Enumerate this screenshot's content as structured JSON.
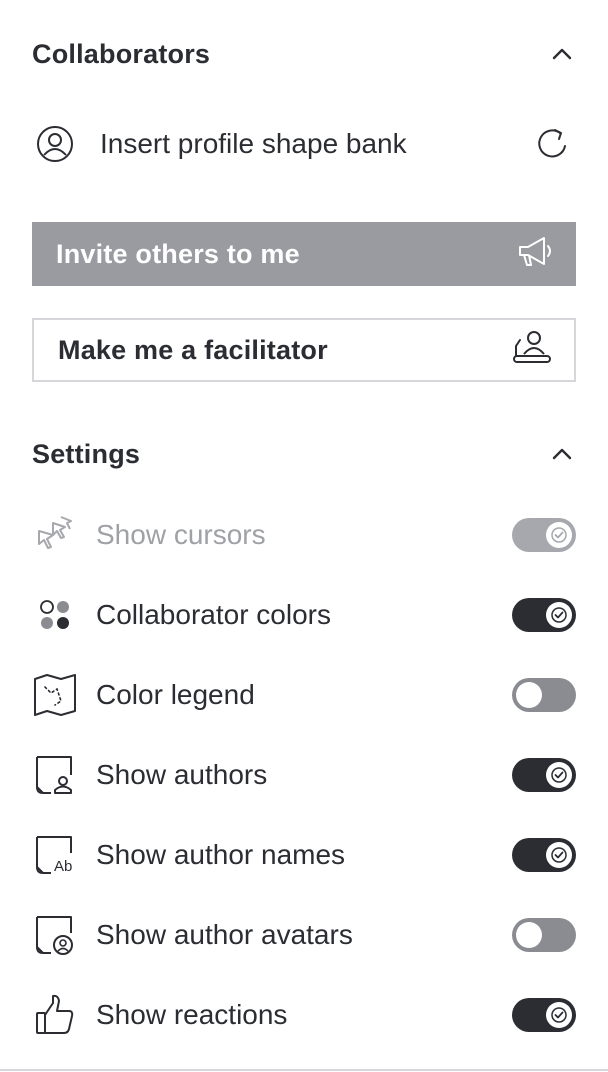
{
  "collaborators": {
    "title": "Collaborators",
    "profile_label": "Insert profile shape bank",
    "invite_label": "Invite others to me",
    "facilitator_label": "Make me a facilitator"
  },
  "settings": {
    "title": "Settings",
    "items": [
      {
        "label": "Show cursors",
        "enabled": true,
        "disabled": true,
        "icon": "cursors-icon"
      },
      {
        "label": "Collaborator colors",
        "enabled": true,
        "disabled": false,
        "icon": "palette-dots-icon"
      },
      {
        "label": "Color legend",
        "enabled": false,
        "disabled": false,
        "icon": "map-legend-icon"
      },
      {
        "label": "Show authors",
        "enabled": true,
        "disabled": false,
        "icon": "sticky-author-icon"
      },
      {
        "label": "Show author names",
        "enabled": true,
        "disabled": false,
        "icon": "sticky-author-name-icon"
      },
      {
        "label": "Show author avatars",
        "enabled": false,
        "disabled": false,
        "icon": "sticky-author-avatar-icon"
      },
      {
        "label": "Show reactions",
        "enabled": true,
        "disabled": false,
        "icon": "thumbs-up-icon"
      }
    ]
  },
  "colors": {
    "text": "#2b2d33",
    "toggle_on": "#2b2d33",
    "toggle_off": "#8a8c92",
    "invite_bg": "#9a9ba0",
    "disabled_text": "#9fa1a6"
  }
}
